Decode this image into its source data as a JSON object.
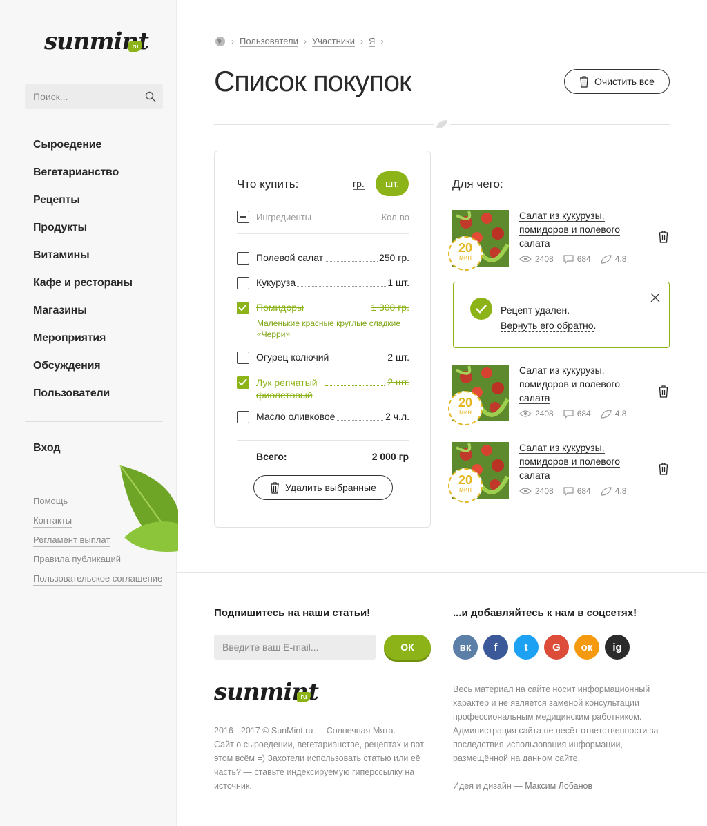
{
  "brand": {
    "name": "sunmint",
    "tld": "ru"
  },
  "search": {
    "placeholder": "Поиск..."
  },
  "nav": {
    "items": [
      "Сыроедение",
      "Вегетарианство",
      "Рецепты",
      "Продукты",
      "Витамины",
      "Кафе и рестораны",
      "Магазины",
      "Мероприятия",
      "Обсуждения",
      "Пользователи"
    ],
    "login": "Вход"
  },
  "side_links": [
    "Помощь",
    "Контакты",
    "Регламент выплат",
    "Правила публикаций",
    "Пользовательское соглашение"
  ],
  "breadcrumb": [
    "Пользователи",
    "Участники",
    "Я"
  ],
  "page": {
    "title": "Список покупок",
    "clear_all": "Очистить все"
  },
  "shopping": {
    "title": "Что купить:",
    "unit_gr": "гр.",
    "unit_pc": "шт.",
    "col_ingredients": "Ингредиенты",
    "col_qty": "Кол-во",
    "items": [
      {
        "name": "Полевой салат",
        "qty": "250 гр.",
        "checked": false
      },
      {
        "name": "Кукуруза",
        "qty": "1 шт.",
        "checked": false
      },
      {
        "name": "Помидоры",
        "qty": "1 300 гр.",
        "checked": true,
        "note": "Маленькие красные круглые сладкие «Черри»"
      },
      {
        "name": "Огурец колючий",
        "qty": "2 шт.",
        "checked": false
      },
      {
        "name": "Лук репчатый фиолетовый",
        "qty": "2 шт.",
        "checked": true
      },
      {
        "name": "Масло оливковое",
        "qty": "2 ч.л.",
        "checked": false
      }
    ],
    "total_label": "Всего:",
    "total_value": "2 000 гр",
    "delete_selected": "Удалить выбранные"
  },
  "recipes": {
    "title": "Для чего:",
    "items": [
      {
        "title": "Салат из кукурузы, помидоров и полевого салата",
        "time": "20",
        "time_unit": "мин",
        "views": "2408",
        "comments": "684",
        "rating": "4.8"
      },
      {
        "title": "Салат из кукурузы, помидоров и полевого салата",
        "time": "20",
        "time_unit": "мин",
        "views": "2408",
        "comments": "684",
        "rating": "4.8"
      },
      {
        "title": "Салат из кукурузы, помидоров и полевого салата",
        "time": "20",
        "time_unit": "мин",
        "views": "2408",
        "comments": "684",
        "rating": "4.8"
      }
    ],
    "toast": {
      "message": "Рецепт удален.",
      "undo": "Вернуть его обратно",
      "undo_end": "."
    }
  },
  "footer": {
    "subscribe_title": "Подпишитесь на наши статьи!",
    "email_placeholder": "Введите ваш E-mail...",
    "ok": "ОК",
    "social_title": "...и добавляйтесь к нам в соцсетях!",
    "social": [
      {
        "name": "vk-icon",
        "label": "вк",
        "color": "#5b7fa6"
      },
      {
        "name": "facebook-icon",
        "label": "f",
        "color": "#3b5998"
      },
      {
        "name": "twitter-icon",
        "label": "t",
        "color": "#1da1f2"
      },
      {
        "name": "google-icon",
        "label": "G",
        "color": "#dd4b39"
      },
      {
        "name": "odnoklassniki-icon",
        "label": "ок",
        "color": "#f59a0e"
      },
      {
        "name": "instagram-icon",
        "label": "ig",
        "color": "#2b2b2b"
      }
    ],
    "copyright_lines": [
      "2016 - 2017 © SunMint.ru — Солнечная Мята.",
      "Сайт о сыроедении, вегетарианстве, рецептах и вот",
      "этом всём =) Захотели использовать статью или её",
      "часть? — ставьте индексируемую гиперссылку на",
      "источник."
    ],
    "disclaimer_lines": [
      "Весь материал на сайте носит информационный",
      "характер и не является заменой консультации",
      "профессиональным медицинским работником.",
      "Администрация сайта не несёт ответственности за",
      "последствия использования информации,",
      "размещённой на данном сайте."
    ],
    "credits_label": "Идея и дизайн — ",
    "credits_author": "Максим Лобанов"
  },
  "colors": {
    "accent": "#8cb318",
    "timer": "#e4b721"
  }
}
